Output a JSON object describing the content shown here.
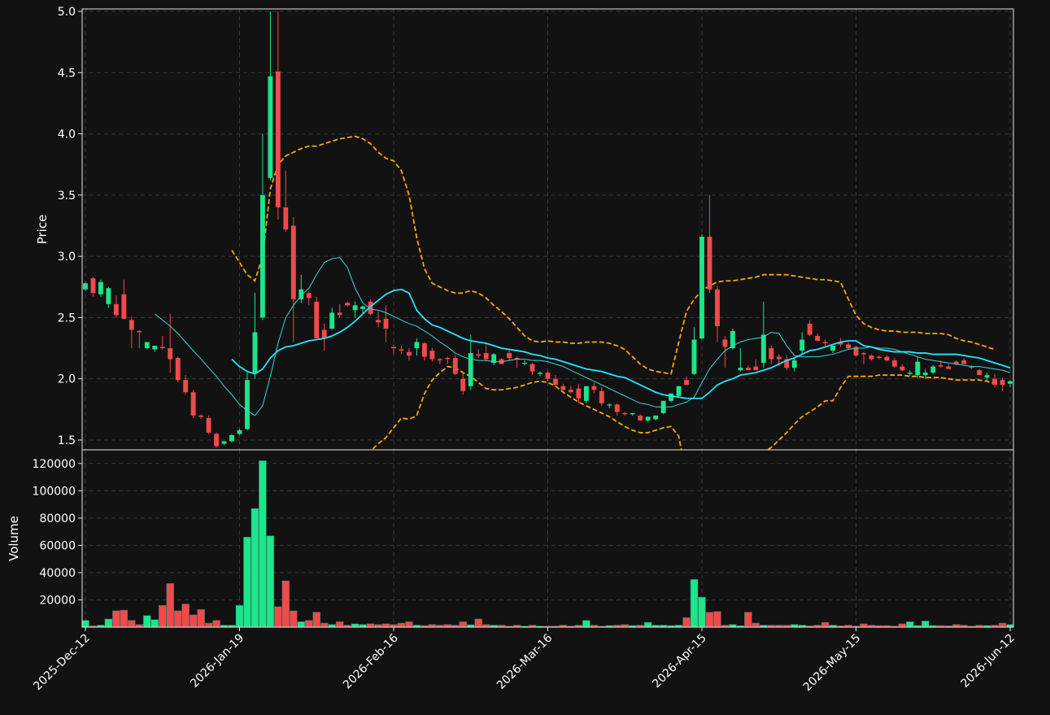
{
  "theme": {
    "background": "#121212",
    "frame": "#e6e6e6",
    "grid": "#3a3a3a",
    "up_color": "#1de58a",
    "down_color": "#f04a4a",
    "ma_fast_color": "#3fd5d5",
    "ma_slow_color": "#22e5ff",
    "band_color": "#ffa500"
  },
  "chart_data": {
    "type": "candlestick",
    "x_tick_labels": [
      "2025-Dec-12",
      "2026-Jan-19",
      "2026-Feb-16",
      "2026-Mar-16",
      "2026-Apr-15",
      "2026-May-15",
      "2026-Jun-12"
    ],
    "x_tick_index": [
      0,
      20,
      40,
      60,
      80,
      100,
      120
    ],
    "price_panel": {
      "ylabel": "Price",
      "ylim": [
        1.42,
        5.02
      ],
      "yticks": [
        1.5,
        2.0,
        2.5,
        3.0,
        3.5,
        4.0,
        4.5,
        5.0
      ],
      "candles": [
        [
          2.73,
          2.79,
          2.72,
          2.78
        ],
        [
          2.82,
          2.83,
          2.67,
          2.7
        ],
        [
          2.69,
          2.81,
          2.67,
          2.79
        ],
        [
          2.61,
          2.75,
          2.58,
          2.74
        ],
        [
          2.61,
          2.68,
          2.5,
          2.52
        ],
        [
          2.69,
          2.81,
          2.5,
          2.49
        ],
        [
          2.48,
          2.51,
          2.25,
          2.4
        ],
        [
          2.39,
          2.4,
          2.25,
          2.38
        ],
        [
          2.25,
          2.3,
          2.24,
          2.3
        ],
        [
          2.24,
          2.27,
          2.22,
          2.27
        ],
        [
          2.26,
          2.35,
          2.24,
          2.25
        ],
        [
          2.25,
          2.53,
          2.05,
          2.16
        ],
        [
          2.17,
          2.18,
          1.97,
          1.99
        ],
        [
          1.99,
          2.03,
          1.87,
          1.89
        ],
        [
          1.89,
          1.91,
          1.68,
          1.7
        ],
        [
          1.7,
          1.71,
          1.67,
          1.69
        ],
        [
          1.68,
          1.7,
          1.55,
          1.56
        ],
        [
          1.55,
          1.56,
          1.44,
          1.45
        ],
        [
          1.47,
          1.49,
          1.46,
          1.49
        ],
        [
          1.49,
          1.55,
          1.48,
          1.54
        ],
        [
          1.55,
          1.59,
          1.54,
          1.58
        ],
        [
          1.59,
          2.05,
          1.58,
          1.99
        ],
        [
          2.05,
          2.7,
          2.0,
          2.38
        ],
        [
          2.5,
          4.0,
          2.48,
          3.5
        ],
        [
          3.64,
          5.0,
          3.62,
          4.47
        ],
        [
          4.51,
          5.0,
          3.3,
          3.4
        ],
        [
          3.4,
          3.7,
          3.2,
          3.22
        ],
        [
          3.25,
          3.32,
          2.3,
          2.65
        ],
        [
          2.65,
          2.85,
          2.62,
          2.73
        ],
        [
          2.7,
          2.72,
          2.6,
          2.66
        ],
        [
          2.63,
          2.67,
          2.37,
          2.33
        ],
        [
          2.4,
          2.45,
          2.23,
          2.33
        ],
        [
          2.41,
          2.58,
          2.4,
          2.54
        ],
        [
          2.54,
          2.61,
          2.5,
          2.52
        ],
        [
          2.62,
          2.63,
          2.59,
          2.6
        ],
        [
          2.56,
          2.63,
          2.5,
          2.6
        ],
        [
          2.57,
          2.6,
          2.53,
          2.59
        ],
        [
          2.63,
          2.65,
          2.52,
          2.53
        ],
        [
          2.48,
          2.55,
          2.42,
          2.46
        ],
        [
          2.49,
          2.6,
          2.3,
          2.41
        ],
        [
          2.26,
          2.28,
          2.2,
          2.25
        ],
        [
          2.24,
          2.27,
          2.2,
          2.23
        ],
        [
          2.22,
          2.25,
          2.15,
          2.19
        ],
        [
          2.25,
          2.33,
          2.19,
          2.3
        ],
        [
          2.29,
          2.3,
          2.15,
          2.18
        ],
        [
          2.23,
          2.25,
          2.14,
          2.16
        ],
        [
          2.16,
          2.17,
          2.12,
          2.15
        ],
        [
          2.17,
          2.18,
          2.12,
          2.16
        ],
        [
          2.17,
          2.2,
          2.03,
          2.04
        ],
        [
          2.0,
          2.05,
          1.87,
          1.9
        ],
        [
          1.94,
          2.36,
          1.91,
          2.21
        ],
        [
          2.2,
          2.24,
          2.17,
          2.19
        ],
        [
          2.21,
          2.29,
          2.14,
          2.16
        ],
        [
          2.13,
          2.21,
          2.11,
          2.2
        ],
        [
          2.16,
          2.17,
          2.12,
          2.12
        ],
        [
          2.21,
          2.24,
          2.15,
          2.17
        ],
        [
          2.17,
          2.18,
          2.09,
          2.16
        ],
        [
          2.13,
          2.15,
          2.11,
          2.13
        ],
        [
          2.12,
          2.13,
          2.03,
          2.06
        ],
        [
          2.04,
          2.06,
          2.02,
          2.05
        ],
        [
          2.05,
          2.06,
          1.98,
          2.0
        ],
        [
          2.0,
          2.03,
          1.94,
          1.95
        ],
        [
          1.94,
          1.96,
          1.9,
          1.91
        ],
        [
          1.91,
          1.94,
          1.88,
          1.89
        ],
        [
          1.92,
          1.96,
          1.8,
          1.84
        ],
        [
          1.82,
          1.93,
          1.8,
          1.94
        ],
        [
          1.94,
          1.97,
          1.88,
          1.91
        ],
        [
          1.9,
          1.93,
          1.78,
          1.8
        ],
        [
          1.79,
          1.8,
          1.76,
          1.79
        ],
        [
          1.79,
          1.8,
          1.7,
          1.73
        ],
        [
          1.72,
          1.73,
          1.7,
          1.71
        ],
        [
          1.71,
          1.72,
          1.7,
          1.72
        ],
        [
          1.7,
          1.71,
          1.66,
          1.66
        ],
        [
          1.66,
          1.69,
          1.65,
          1.69
        ],
        [
          1.67,
          1.7,
          1.66,
          1.7
        ],
        [
          1.72,
          1.82,
          1.71,
          1.82
        ],
        [
          1.82,
          1.88,
          1.81,
          1.88
        ],
        [
          1.86,
          1.94,
          1.85,
          1.94
        ],
        [
          1.99,
          2.02,
          1.95,
          1.95
        ],
        [
          2.04,
          2.42,
          2.03,
          2.32
        ],
        [
          2.33,
          3.18,
          2.32,
          3.16
        ],
        [
          3.16,
          3.5,
          2.7,
          2.73
        ],
        [
          2.73,
          2.76,
          2.3,
          2.43
        ],
        [
          2.32,
          2.35,
          2.09,
          2.26
        ],
        [
          2.25,
          2.41,
          2.24,
          2.39
        ],
        [
          2.07,
          2.25,
          2.06,
          2.09
        ],
        [
          2.09,
          2.11,
          2.07,
          2.07
        ],
        [
          2.1,
          2.16,
          2.08,
          2.07
        ],
        [
          2.13,
          2.63,
          2.09,
          2.36
        ],
        [
          2.25,
          2.27,
          2.12,
          2.16
        ],
        [
          2.18,
          2.2,
          2.1,
          2.16
        ],
        [
          2.16,
          2.19,
          2.07,
          2.09
        ],
        [
          2.09,
          2.17,
          2.06,
          2.15
        ],
        [
          2.23,
          2.38,
          2.2,
          2.32
        ],
        [
          2.45,
          2.48,
          2.35,
          2.36
        ],
        [
          2.35,
          2.37,
          2.31,
          2.31
        ],
        [
          2.3,
          2.32,
          2.27,
          2.29
        ],
        [
          2.23,
          2.27,
          2.21,
          2.27
        ],
        [
          2.3,
          2.33,
          2.26,
          2.28
        ],
        [
          2.28,
          2.3,
          2.24,
          2.25
        ],
        [
          2.26,
          2.27,
          2.18,
          2.19
        ],
        [
          2.21,
          2.22,
          2.12,
          2.2
        ],
        [
          2.19,
          2.2,
          2.15,
          2.16
        ],
        [
          2.18,
          2.19,
          2.16,
          2.17
        ],
        [
          2.18,
          2.19,
          2.14,
          2.15
        ],
        [
          2.15,
          2.17,
          2.09,
          2.1
        ],
        [
          2.1,
          2.12,
          2.06,
          2.07
        ],
        [
          2.04,
          2.07,
          2.02,
          2.05
        ],
        [
          2.03,
          2.18,
          2.01,
          2.14
        ],
        [
          2.03,
          2.08,
          2.0,
          2.05
        ],
        [
          2.05,
          2.11,
          2.04,
          2.1
        ],
        [
          2.11,
          2.15,
          2.09,
          2.1
        ],
        [
          2.1,
          2.12,
          2.08,
          2.08
        ],
        [
          2.14,
          2.15,
          2.11,
          2.12
        ],
        [
          2.15,
          2.17,
          2.12,
          2.12
        ],
        [
          2.1,
          2.11,
          2.08,
          2.09
        ],
        [
          2.07,
          2.08,
          2.03,
          2.03
        ],
        [
          2.01,
          2.05,
          1.98,
          2.03
        ],
        [
          2.0,
          2.04,
          1.93,
          1.95
        ],
        [
          1.99,
          2.01,
          1.9,
          1.95
        ],
        [
          1.96,
          1.99,
          1.93,
          1.98
        ]
      ],
      "ma_fast": [
        null,
        null,
        null,
        null,
        null,
        null,
        null,
        null,
        null,
        2.53,
        2.48,
        2.43,
        2.37,
        2.3,
        2.23,
        2.16,
        2.09,
        2.02,
        1.94,
        1.87,
        1.79,
        1.74,
        1.7,
        1.78,
        2.02,
        2.29,
        2.5,
        2.6,
        2.68,
        2.74,
        2.85,
        2.95,
        2.98,
        2.99,
        2.91,
        2.74,
        2.62,
        2.57,
        2.56,
        2.54,
        2.51,
        2.48,
        2.45,
        2.43,
        2.39,
        2.35,
        2.3,
        2.26,
        2.21,
        2.18,
        2.16,
        2.15,
        2.15,
        2.14,
        2.14,
        2.15,
        2.16,
        2.16,
        2.15,
        2.15,
        2.14,
        2.12,
        2.1,
        2.07,
        2.04,
        2.01,
        1.98,
        1.95,
        1.92,
        1.89,
        1.86,
        1.83,
        1.8,
        1.79,
        1.77,
        1.77,
        1.77,
        1.79,
        1.81,
        1.85,
        1.97,
        2.08,
        2.16,
        2.23,
        2.27,
        2.3,
        2.32,
        2.33,
        2.34,
        2.38,
        2.37,
        2.27,
        2.19,
        2.18,
        2.18,
        2.18,
        2.19,
        2.2,
        2.22,
        2.24,
        2.25,
        2.25,
        2.26,
        2.25,
        2.25,
        2.24,
        2.22,
        2.2,
        2.18,
        2.16,
        2.15,
        2.14,
        2.13,
        2.12,
        2.11,
        2.1,
        2.1,
        2.09,
        2.08,
        2.07,
        2.05
      ],
      "ma_slow": [
        null,
        null,
        null,
        null,
        null,
        null,
        null,
        null,
        null,
        null,
        null,
        null,
        null,
        null,
        null,
        null,
        null,
        null,
        null,
        2.16,
        2.1,
        2.06,
        2.04,
        2.08,
        2.17,
        2.23,
        2.26,
        2.27,
        2.29,
        2.31,
        2.32,
        2.33,
        2.35,
        2.38,
        2.42,
        2.47,
        2.53,
        2.59,
        2.64,
        2.69,
        2.72,
        2.73,
        2.7,
        2.56,
        2.49,
        2.44,
        2.42,
        2.39,
        2.36,
        2.33,
        2.31,
        2.3,
        2.29,
        2.27,
        2.25,
        2.24,
        2.23,
        2.22,
        2.2,
        2.19,
        2.17,
        2.16,
        2.14,
        2.12,
        2.1,
        2.08,
        2.07,
        2.06,
        2.04,
        2.02,
        2.01,
        1.98,
        1.95,
        1.92,
        1.89,
        1.87,
        1.86,
        1.85,
        1.84,
        1.84,
        1.84,
        1.89,
        1.95,
        1.98,
        2.0,
        2.03,
        2.04,
        2.05,
        2.07,
        2.09,
        2.12,
        2.15,
        2.17,
        2.2,
        2.23,
        2.24,
        2.26,
        2.28,
        2.3,
        2.31,
        2.31,
        2.27,
        2.26,
        2.24,
        2.23,
        2.22,
        2.22,
        2.22,
        2.21,
        2.21,
        2.2,
        2.2,
        2.2,
        2.2,
        2.19,
        2.18,
        2.17,
        2.15,
        2.13,
        2.11,
        2.09
      ],
      "band_upper": [
        null,
        null,
        null,
        null,
        null,
        null,
        null,
        null,
        null,
        null,
        null,
        null,
        null,
        null,
        null,
        null,
        null,
        null,
        null,
        3.05,
        2.95,
        2.85,
        2.8,
        3.0,
        3.55,
        3.75,
        3.82,
        3.85,
        3.88,
        3.9,
        3.9,
        3.92,
        3.94,
        3.96,
        3.97,
        3.98,
        3.96,
        3.92,
        3.85,
        3.8,
        3.78,
        3.7,
        3.5,
        3.15,
        2.9,
        2.78,
        2.75,
        2.72,
        2.7,
        2.7,
        2.72,
        2.7,
        2.66,
        2.6,
        2.55,
        2.49,
        2.42,
        2.35,
        2.31,
        2.3,
        2.31,
        2.3,
        2.3,
        2.29,
        2.29,
        2.3,
        2.3,
        2.3,
        2.29,
        2.27,
        2.24,
        2.18,
        2.12,
        2.08,
        2.06,
        2.05,
        2.04,
        2.3,
        2.55,
        2.65,
        2.72,
        2.76,
        2.79,
        2.8,
        2.8,
        2.81,
        2.82,
        2.83,
        2.85,
        2.85,
        2.85,
        2.85,
        2.84,
        2.83,
        2.82,
        2.81,
        2.81,
        2.8,
        2.79,
        2.65,
        2.52,
        2.45,
        2.42,
        2.4,
        2.39,
        2.39,
        2.38,
        2.38,
        2.38,
        2.37,
        2.37,
        2.37,
        2.36,
        2.33,
        2.31,
        2.3,
        2.28,
        2.26,
        2.24
      ],
      "band_lower": [
        null,
        null,
        null,
        null,
        null,
        null,
        null,
        null,
        null,
        null,
        null,
        null,
        null,
        null,
        null,
        null,
        null,
        null,
        null,
        0.9,
        0.95,
        1.0,
        1.05,
        1.1,
        1.15,
        1.2,
        1.25,
        1.3,
        1.33,
        1.35,
        1.37,
        1.38,
        1.38,
        1.38,
        1.38,
        1.39,
        1.4,
        1.41,
        1.47,
        1.52,
        1.6,
        1.68,
        1.67,
        1.7,
        1.88,
        1.99,
        2.05,
        2.1,
        2.09,
        2.05,
        2.02,
        1.97,
        1.92,
        1.91,
        1.91,
        1.92,
        1.93,
        1.95,
        1.97,
        1.98,
        1.97,
        1.94,
        1.89,
        1.85,
        1.81,
        1.78,
        1.75,
        1.72,
        1.69,
        1.65,
        1.61,
        1.58,
        1.56,
        1.56,
        1.58,
        1.6,
        1.61,
        1.53,
        1.2,
        1.0,
        1.0,
        1.05,
        1.1,
        1.15,
        1.2,
        1.25,
        1.3,
        1.35,
        1.4,
        1.44,
        1.5,
        1.56,
        1.63,
        1.69,
        1.73,
        1.77,
        1.82,
        1.82,
        1.93,
        2.02,
        2.02,
        2.02,
        2.02,
        2.03,
        2.03,
        2.03,
        2.03,
        2.02,
        2.02,
        2.01,
        2.01,
        2.01,
        2.0,
        1.99,
        1.99,
        1.99,
        1.99,
        1.98,
        1.96
      ]
    },
    "volume_panel": {
      "ylabel": "Volume",
      "ylim": [
        0,
        130000
      ],
      "yticks": [
        20000,
        40000,
        60000,
        80000,
        100000,
        120000
      ],
      "volumes": [
        5000,
        1000,
        1500,
        6000,
        12000,
        12500,
        5000,
        2000,
        8500,
        5500,
        16000,
        32000,
        12000,
        17000,
        9000,
        13000,
        3000,
        5000,
        1500,
        1500,
        16000,
        66000,
        87000,
        122000,
        67000,
        15000,
        34000,
        12000,
        4000,
        5000,
        11000,
        3000,
        2000,
        4000,
        1500,
        2500,
        2000,
        2500,
        2000,
        2500,
        2000,
        3000,
        4000,
        1500,
        1200,
        2000,
        1500,
        2000,
        1500,
        4000,
        1800,
        6000,
        2000,
        1500,
        1500,
        800,
        1500,
        800,
        1500,
        800,
        800,
        800,
        1500,
        800,
        1500,
        5000,
        1500,
        800,
        1200,
        1500,
        2000,
        1200,
        1500,
        3500,
        1500,
        1500,
        1200,
        1500,
        7000,
        35000,
        22000,
        11000,
        11500,
        1500,
        2000,
        1000,
        11000,
        3000,
        1500,
        1500,
        1500,
        1500,
        2000,
        1500,
        1000,
        1500,
        3500,
        1500,
        1000,
        1500,
        800,
        2500,
        1500,
        1200,
        1200,
        800,
        2500,
        4000,
        1200,
        4500,
        1200,
        1200,
        1000,
        2000,
        1500,
        800,
        1500,
        1200,
        1500,
        3000,
        2000
      ]
    }
  }
}
